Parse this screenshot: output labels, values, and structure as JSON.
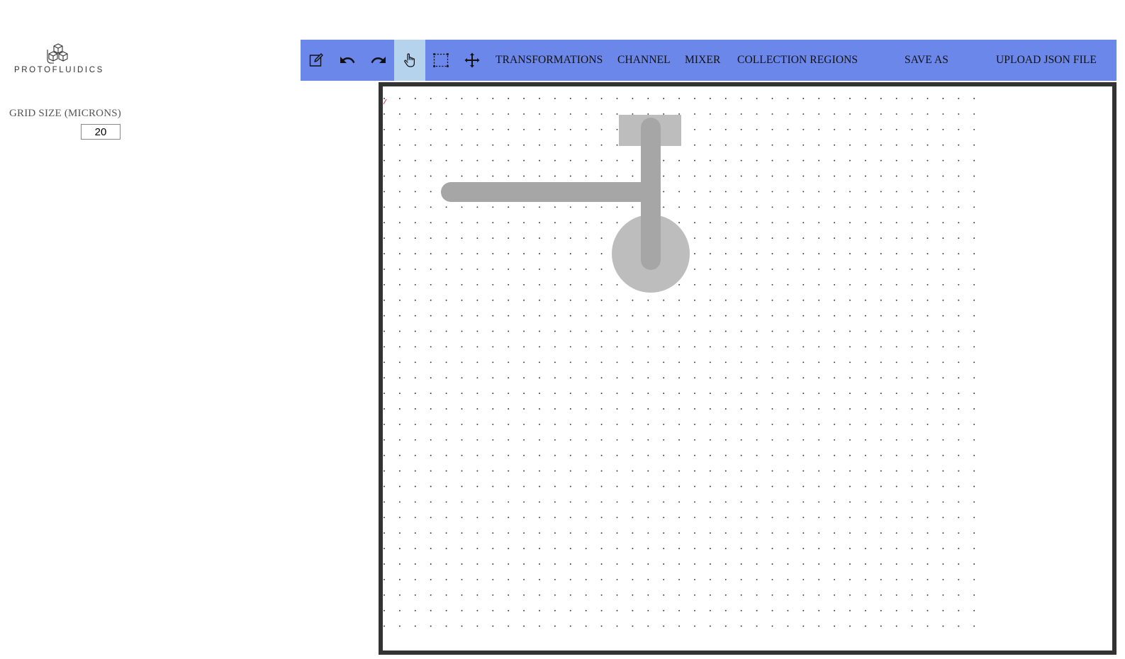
{
  "logo": {
    "text": "PROTOFLUIDICS"
  },
  "sidebar": {
    "grid_size_label": "GRID SIZE (MICRONS)",
    "grid_size_value": "20"
  },
  "toolbar": {
    "tools": [
      {
        "name": "edit",
        "icon": "edit-icon"
      },
      {
        "name": "undo",
        "icon": "undo-icon"
      },
      {
        "name": "redo",
        "icon": "redo-icon"
      },
      {
        "name": "pan",
        "icon": "hand-icon",
        "active": true
      },
      {
        "name": "select",
        "icon": "marquee-select-icon"
      },
      {
        "name": "move",
        "icon": "move-icon"
      }
    ],
    "menu": {
      "transformations": "TRANSFORMATIONS",
      "channel": "CHANNEL",
      "mixer": "MIXER",
      "collection_regions": "COLLECTION REGIONS",
      "save_as": "SAVE AS",
      "upload_json": "UPLOAD JSON FILE"
    },
    "colors": {
      "background": "#6b87ea",
      "active_tool": "#b6d3ee"
    }
  },
  "canvas": {
    "colors": {
      "border": "#333333",
      "grid_dot": "#333333",
      "shape_fill": "#bdbdbd",
      "channel": "#a6a6a6"
    }
  }
}
